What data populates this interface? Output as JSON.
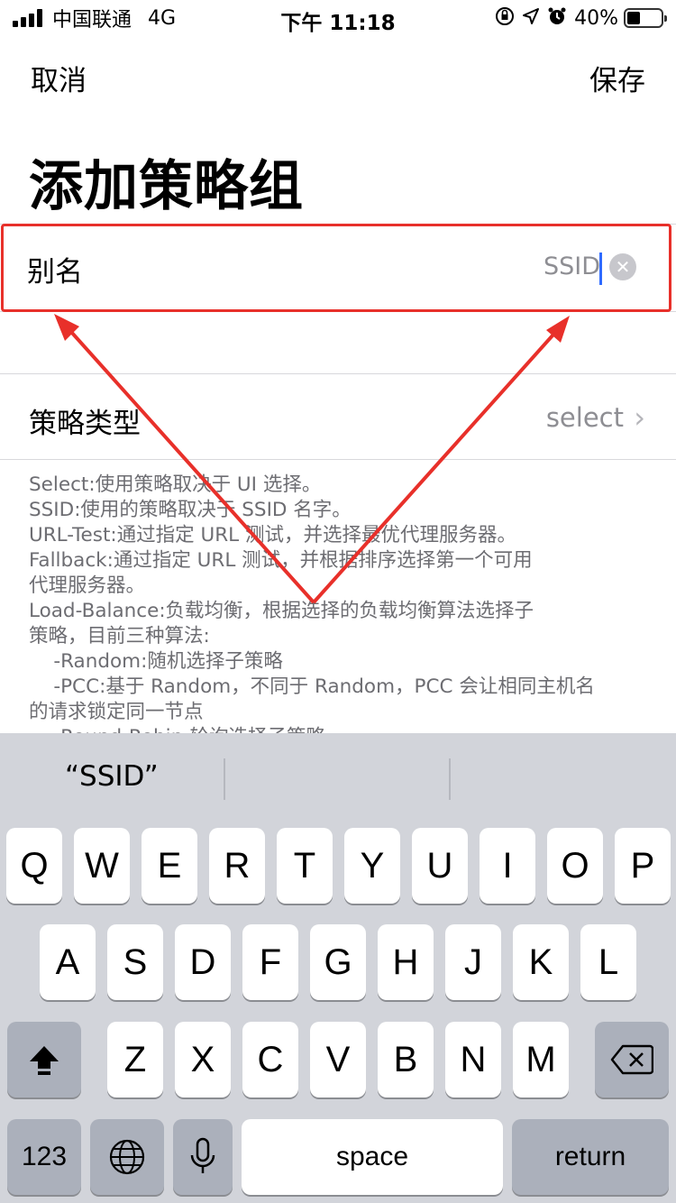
{
  "status": {
    "carrier": "中国联通",
    "network": "4G",
    "time": "下午 11:18",
    "battery_text": "40%",
    "battery_level": 0.4,
    "icons": [
      "signal-icon",
      "orientation-lock-icon",
      "location-arrow-icon",
      "alarm-icon",
      "battery-icon"
    ]
  },
  "nav": {
    "cancel_label": "取消",
    "save_label": "保存"
  },
  "title": "添加策略组",
  "alias": {
    "label": "别名",
    "value": "SSID"
  },
  "policy_type": {
    "label": "策略类型",
    "value": "select"
  },
  "description": "Select:使用策略取决于 UI 选择。\nSSID:使用的策略取决于 SSID 名字。\nURL-Test:通过指定 URL 测试，并选择最优代理服务器。\nFallback:通过指定 URL 测试，并根据排序选择第一个可用\n代理服务器。\nLoad-Balance:负载均衡，根据选择的负载均衡算法选择子\n策略，目前三种算法:\n    -Random:随机选择子策略\n    -PCC:基于 Random，不同于 Random，PCC 会让相同主机名\n的请求锁定同一节点\n    -Round-Robin:轮询选择子策略",
  "keyboard": {
    "suggestion": "“SSID”",
    "row1": [
      "Q",
      "W",
      "E",
      "R",
      "T",
      "Y",
      "U",
      "I",
      "O",
      "P"
    ],
    "row2": [
      "A",
      "S",
      "D",
      "F",
      "G",
      "H",
      "J",
      "K",
      "L"
    ],
    "row3": [
      "Z",
      "X",
      "C",
      "V",
      "B",
      "N",
      "M"
    ],
    "numbers_label": "123",
    "space_label": "space",
    "return_label": "return"
  },
  "colors": {
    "highlight": "#e8302a",
    "cursor": "#2f6bff",
    "keyboard_bg": "#d2d4da",
    "secondary_text": "#8e8e93"
  }
}
